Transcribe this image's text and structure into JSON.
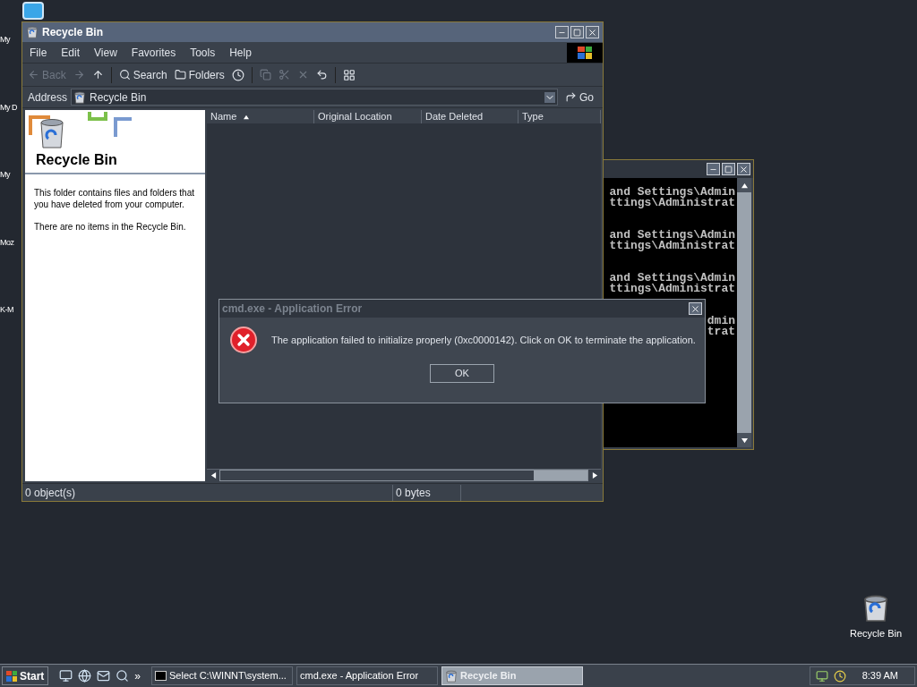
{
  "desktop": {
    "left_icons": [
      {
        "label": "My"
      },
      {
        "label": "My D"
      },
      {
        "label": "My"
      },
      {
        "label": "Moz"
      },
      {
        "label": "K-M"
      }
    ],
    "right_icon": {
      "label": "Recycle Bin"
    }
  },
  "explorer": {
    "title": "Recycle Bin",
    "menu": [
      "File",
      "Edit",
      "View",
      "Favorites",
      "Tools",
      "Help"
    ],
    "toolbar": [
      {
        "kind": "back",
        "label": "Back",
        "disabled": true
      },
      {
        "kind": "search",
        "label": "Search",
        "disabled": false
      },
      {
        "kind": "folders",
        "label": "Folders",
        "disabled": false
      }
    ],
    "address": {
      "label": "Address",
      "value": "Recycle Bin",
      "go": "Go"
    },
    "sidebar": {
      "heading": "Recycle Bin",
      "paragraphs": [
        "This folder contains files and folders that you have deleted from your computer.",
        "There are no items in the Recycle Bin."
      ]
    },
    "columns": [
      {
        "label": "Name",
        "sorted": true
      },
      {
        "label": "Original Location",
        "sorted": false
      },
      {
        "label": "Date Deleted",
        "sorted": false
      },
      {
        "label": "Type",
        "sorted": false
      }
    ],
    "status_bar": [
      "0 object(s)",
      "0 bytes"
    ]
  },
  "console": {
    "blocks": [
      [
        "and Settings\\Admin",
        "ttings\\Administrat"
      ],
      [
        "and Settings\\Admin",
        "ttings\\Administrat"
      ],
      [
        "and Settings\\Admin",
        "ttings\\Administrat"
      ],
      [
        "dmin",
        "trat"
      ]
    ]
  },
  "dialog": {
    "title": "cmd.exe - Application Error",
    "message": "The application failed to initialize properly (0xc0000142). Click on OK to terminate the application.",
    "button": "OK"
  },
  "taskbar": {
    "start": "Start",
    "more": "»",
    "tasks": [
      {
        "kind": "console",
        "label": "Select C:\\WINNT\\system...",
        "selected": false
      },
      {
        "kind": "plain",
        "label": "cmd.exe - Application Error",
        "selected": false
      },
      {
        "kind": "bin",
        "label": "Recycle Bin",
        "selected": true
      }
    ],
    "clock": "8:39 AM"
  }
}
